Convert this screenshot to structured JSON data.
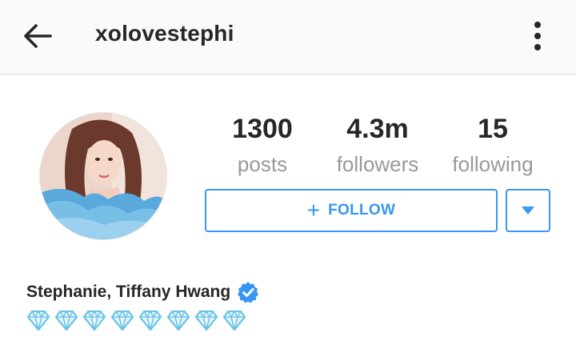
{
  "header": {
    "username": "xolovestephi",
    "back_icon": "arrow-left-icon",
    "menu_icon": "more-vertical-icon"
  },
  "stats": {
    "posts": {
      "value": "1300",
      "label": "posts"
    },
    "followers": {
      "value": "4.3m",
      "label": "followers"
    },
    "following": {
      "value": "15",
      "label": "following"
    }
  },
  "actions": {
    "follow_plus": "+",
    "follow_label": "FOLLOW",
    "dropdown_icon": "caret-down-icon"
  },
  "profile": {
    "full_name": "Stephanie, Tiffany Hwang",
    "verified": true,
    "bio_emoji": "💎",
    "bio_emoji_count": 8
  },
  "colors": {
    "accent": "#3897f0",
    "text": "#262626",
    "muted": "#999999",
    "verified": "#3897f0",
    "diamond": "#6cc4e8"
  }
}
